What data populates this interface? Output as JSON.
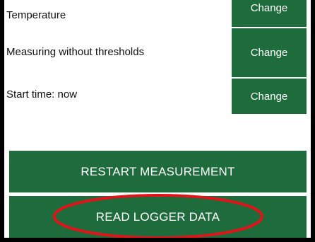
{
  "settings": [
    {
      "label": "Temperature",
      "button": "Change"
    },
    {
      "label": "Measuring without thresholds",
      "button": "Change"
    },
    {
      "label": "Start time: now",
      "button": "Change"
    }
  ],
  "actions": {
    "restart_label": "RESTART MEASUREMENT",
    "read_label": "READ LOGGER DATA"
  },
  "colors": {
    "button_green": "#1e6b3c",
    "highlight_red": "#e0141b",
    "background": "#ffffff",
    "frame": "#000000"
  },
  "annotation": {
    "type": "red-oval-highlight",
    "target": "read-logger-data-button"
  }
}
